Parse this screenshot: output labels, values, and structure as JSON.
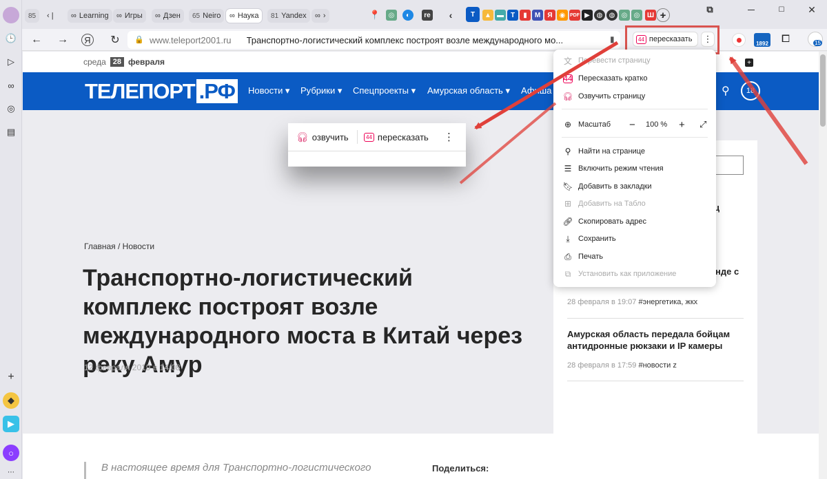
{
  "tabs": [
    {
      "num": "85",
      "label": ""
    },
    {
      "num": "",
      "label": "Learning"
    },
    {
      "num": "",
      "label": "Игры"
    },
    {
      "num": "",
      "label": "Дзен"
    },
    {
      "num": "65",
      "label": "Neiro"
    },
    {
      "num": "",
      "label": "Наука"
    },
    {
      "num": "81",
      "label": "Yandex"
    }
  ],
  "tab_strip": {
    "new_tab": "+",
    "mail_badge": "1892",
    "ext_badge": "15"
  },
  "toolbar": {
    "url": "www.teleport2001.ru",
    "page_title": "Транспортно-логистический комплекс построят возле международного мо...",
    "retell_label": "пересказать",
    "retell_icon_text": "44"
  },
  "site": {
    "weekday": "среда",
    "day": "28",
    "month": "февраля",
    "logo_main": "ТЕЛЕПОРТ",
    "logo_suffix": ".РФ",
    "nav": [
      "Новости ▾",
      "Рубрики ▾",
      "Спецпроекты ▾",
      "Амурская область ▾",
      "Афиша"
    ],
    "age_badge": "18"
  },
  "floating_panel": {
    "voice_label": "озвучить",
    "retell_label": "пересказать",
    "retell_icon_text": "44"
  },
  "menu": {
    "translate": "Перевести страницу",
    "retell_short": "Пересказать кратко",
    "voice_page": "Озвучить страницу",
    "zoom_label": "Масштаб",
    "zoom_minus": "−",
    "zoom_value": "100 %",
    "zoom_plus": "+",
    "find": "Найти на странице",
    "reader": "Включить режим чтения",
    "bookmark": "Добавить в закладки",
    "tablo": "Добавить на Табло",
    "copy_addr": "Скопировать адрес",
    "save": "Сохранить",
    "print": "Печать",
    "install": "Установить как приложение"
  },
  "article": {
    "breadcrumb": "Главная  /  Новости",
    "headline": "Транспортно-логистический комплекс построят возле международного моста в Китай через реку Амур",
    "date": "12 февраля 2019 в 14:08",
    "lead": "В настоящее время для Транспортно-логистического",
    "share_label": "Поделиться:"
  },
  "sidebar": {
    "partial_1": "ц",
    "partial_2": "нде с",
    "items": [
      {
        "meta_date": "28 февраля в 19:07",
        "meta_tag": "#энергетика, жкх"
      },
      {
        "title": "Амурская область передала бойцам антидронные рюкзаки и IP камеры",
        "meta_date": "28 февраля в 17:59",
        "meta_tag": "#новости z"
      }
    ]
  },
  "colors": {
    "accent_red": "#d9534f",
    "site_blue": "#0b5bc4",
    "pink_icon": "#e0457b"
  }
}
